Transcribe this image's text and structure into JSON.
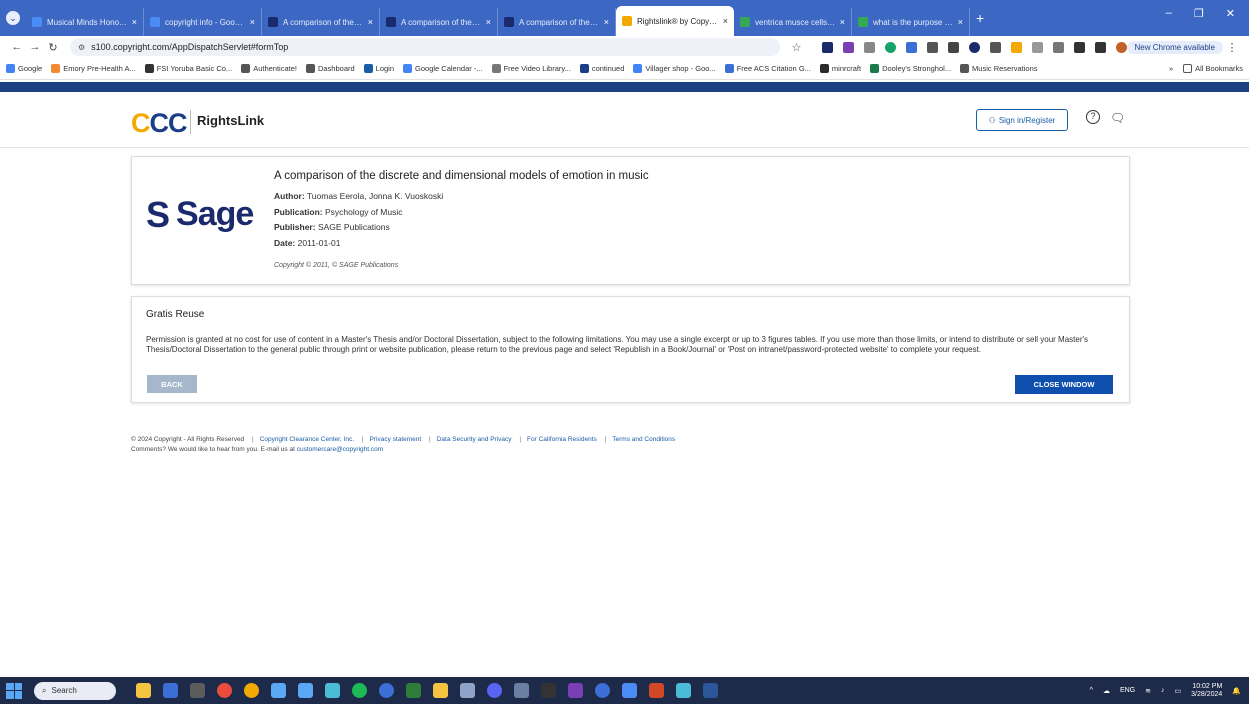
{
  "browser": {
    "tabs": [
      {
        "title": "Musical Minds Honors Th",
        "icon": "doc-icon",
        "color": "#4b8bf5"
      },
      {
        "title": "copyright info - Google D",
        "icon": "doc-icon",
        "color": "#4b8bf5"
      },
      {
        "title": "A comparison of the disc",
        "icon": "s-icon",
        "color": "#1a2a6c"
      },
      {
        "title": "A comparison of the disc",
        "icon": "s-icon",
        "color": "#1a2a6c"
      },
      {
        "title": "A comparison of the disc",
        "icon": "s-icon",
        "color": "#1a2a6c"
      },
      {
        "title": "Rightslink® by Copyright",
        "icon": "rightslink-icon",
        "color": "#f2a900",
        "active": true
      },
      {
        "title": "ventrica musce cells - Go",
        "icon": "google-icon",
        "color": "#34a853"
      },
      {
        "title": "what is the purpose of ca",
        "icon": "google-icon",
        "color": "#34a853"
      }
    ],
    "url": "s100.copyright.com/AppDispatchServlet#formTop",
    "new_chrome": "New Chrome available",
    "bookmarks": [
      {
        "label": "Google",
        "color": "#4285f4"
      },
      {
        "label": "Emory Pre-Health A...",
        "color": "#f28b30"
      },
      {
        "label": "FSI Yoruba Basic Co...",
        "color": "#333333"
      },
      {
        "label": "Authenticate!",
        "color": "#555555"
      },
      {
        "label": "Dashboard",
        "color": "#555555"
      },
      {
        "label": "Login",
        "color": "#1a5ea8"
      },
      {
        "label": "Google Calendar -...",
        "color": "#4285f4"
      },
      {
        "label": "Free Video Library...",
        "color": "#777777"
      },
      {
        "label": "continued",
        "color": "#1a3f87"
      },
      {
        "label": "Villager shop - Goo...",
        "color": "#4285f4"
      },
      {
        "label": "Free ACS Citation G...",
        "color": "#3b6fd6"
      },
      {
        "label": "minrcraft",
        "color": "#2b2b2b"
      },
      {
        "label": "Dooley's Stronghol...",
        "color": "#1a7a4a"
      },
      {
        "label": "Music Reservations",
        "color": "#555555"
      }
    ],
    "bookmarks_more": "»",
    "all_bookmarks": "All Bookmarks"
  },
  "site": {
    "logo_c1": "C",
    "logo_c2": "CC",
    "brand": "RightsLink",
    "sign_in": "Sign in/Register",
    "help": "?"
  },
  "article": {
    "publisher_logo": "Sage",
    "title": "A comparison of the discrete and dimensional models of emotion in music",
    "author_label": "Author:",
    "author": "Tuomas Eerola, Jonna K. Vuoskoski",
    "publication_label": "Publication:",
    "publication": "Psychology of Music",
    "publisher_label": "Publisher:",
    "publisher": "SAGE Publications",
    "date_label": "Date:",
    "date": "2011-01-01",
    "copyright": "Copyright © 2011, © SAGE Publications"
  },
  "reuse": {
    "title": "Gratis Reuse",
    "text": "Permission is granted at no cost for use of content in a Master's Thesis and/or Doctoral Dissertation, subject to the following limitations. You may  use a single excerpt or up to 3 figures tables. If you use more than those limits, or intend to distribute or sell your Master's Thesis/Doctoral Dissertation to the general public through print or website publication, please return to the previous page and select 'Republish in a Book/Journal' or 'Post on intranet/password-protected website' to complete your request.",
    "back": "BACK",
    "close": "CLOSE WINDOW"
  },
  "footer": {
    "copyright": "© 2024 Copyright - All Rights Reserved",
    "links": [
      "Copyright Clearance Center, Inc.",
      "Privacy statement",
      "Data Security and Privacy",
      "For California Residents",
      "Terms and Conditions"
    ],
    "comments": "Comments? We would like to hear from you. E-mail us at",
    "email": "customercare@copyright.com"
  },
  "taskbar": {
    "search": "Search",
    "lang": "ENG",
    "time": "10:02 PM",
    "date": "3/28/2024"
  }
}
